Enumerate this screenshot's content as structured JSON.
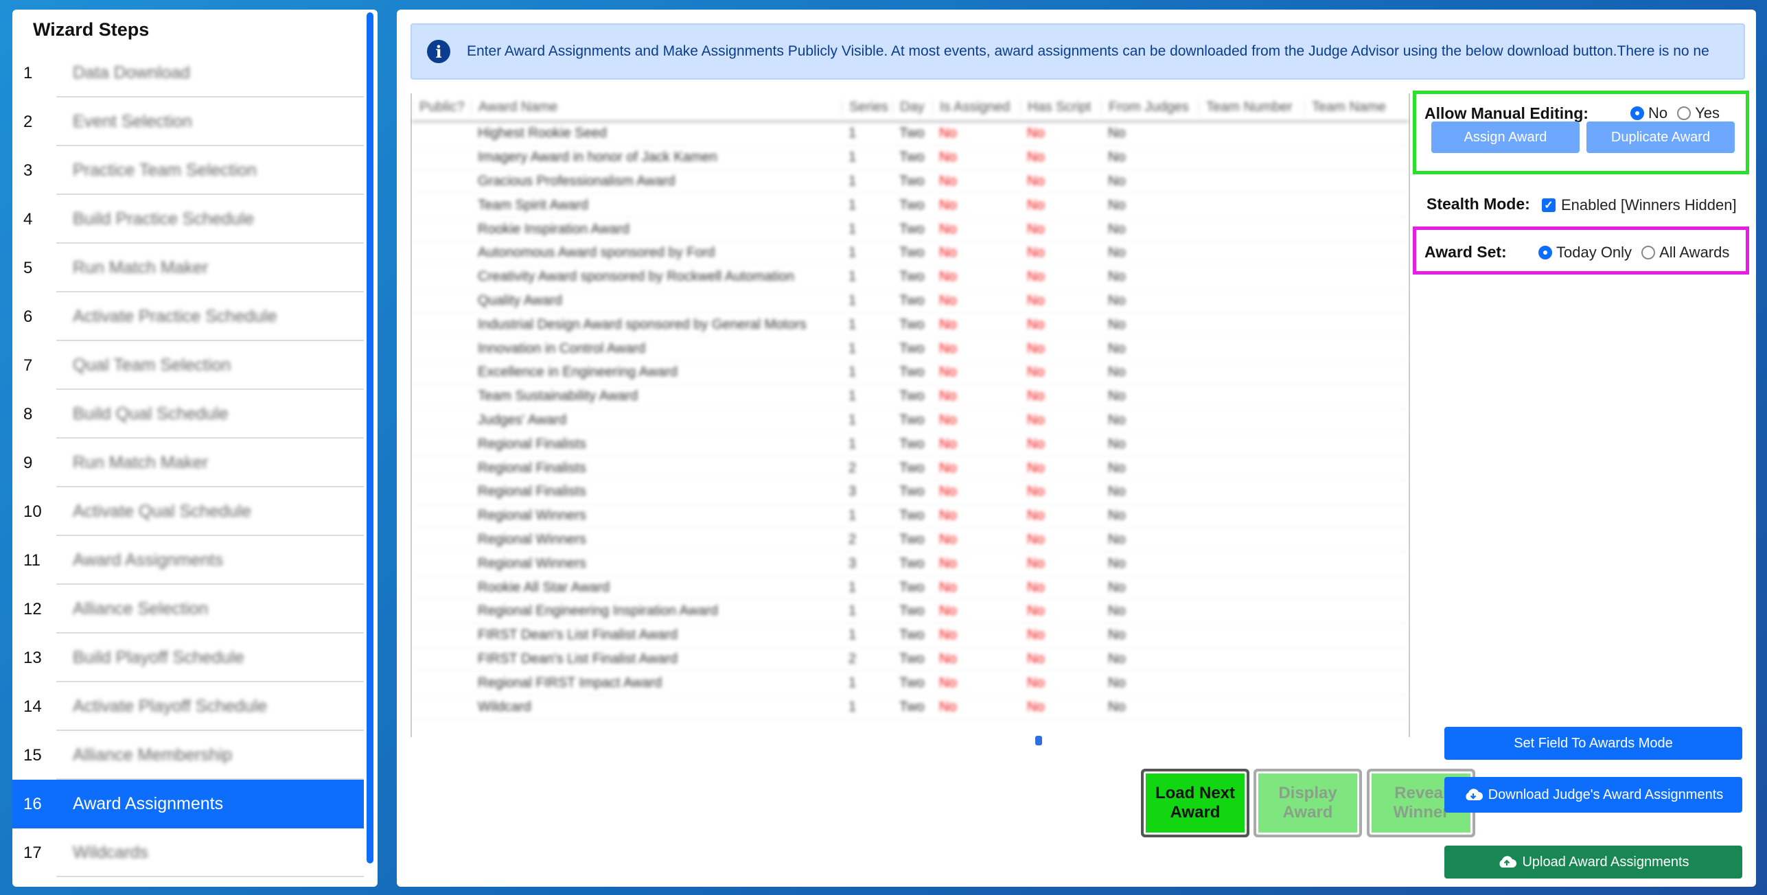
{
  "sidebar": {
    "title": "Wizard Steps",
    "steps": [
      {
        "num": "1",
        "label": "Data Download"
      },
      {
        "num": "2",
        "label": "Event Selection"
      },
      {
        "num": "3",
        "label": "Practice Team Selection"
      },
      {
        "num": "4",
        "label": "Build Practice Schedule"
      },
      {
        "num": "5",
        "label": "Run Match Maker"
      },
      {
        "num": "6",
        "label": "Activate Practice Schedule"
      },
      {
        "num": "7",
        "label": "Qual Team Selection"
      },
      {
        "num": "8",
        "label": "Build Qual Schedule"
      },
      {
        "num": "9",
        "label": "Run Match Maker"
      },
      {
        "num": "10",
        "label": "Activate Qual Schedule"
      },
      {
        "num": "11",
        "label": "Award Assignments"
      },
      {
        "num": "12",
        "label": "Alliance Selection"
      },
      {
        "num": "13",
        "label": "Build Playoff Schedule"
      },
      {
        "num": "14",
        "label": "Activate Playoff Schedule"
      },
      {
        "num": "15",
        "label": "Alliance Membership"
      },
      {
        "num": "16",
        "label": "Award Assignments"
      },
      {
        "num": "17",
        "label": "Wildcards"
      }
    ],
    "active_step": "16"
  },
  "banner": {
    "icon": "info-icon",
    "text": "Enter Award Assignments and Make Assignments Publicly Visible. At most events, award assignments can be downloaded from the Judge Advisor using the below download button.There is no ne"
  },
  "table": {
    "columns": [
      "Public?",
      "Award Name",
      "Series",
      "Day",
      "Is Assigned",
      "Has Script",
      "From Judges",
      "Team Number",
      "Team Name"
    ],
    "rows": [
      [
        "",
        "Highest Rookie Seed",
        "1",
        "Two",
        "No",
        "No",
        "No"
      ],
      [
        "",
        "Imagery Award in honor of Jack Kamen",
        "1",
        "Two",
        "No",
        "No",
        "No"
      ],
      [
        "",
        "Gracious Professionalism Award",
        "1",
        "Two",
        "No",
        "No",
        "No"
      ],
      [
        "",
        "Team Spirit Award",
        "1",
        "Two",
        "No",
        "No",
        "No"
      ],
      [
        "",
        "Rookie Inspiration Award",
        "1",
        "Two",
        "No",
        "No",
        "No"
      ],
      [
        "",
        "Autonomous Award sponsored by Ford",
        "1",
        "Two",
        "No",
        "No",
        "No"
      ],
      [
        "",
        "Creativity Award sponsored by Rockwell Automation",
        "1",
        "Two",
        "No",
        "No",
        "No"
      ],
      [
        "",
        "Quality Award",
        "1",
        "Two",
        "No",
        "No",
        "No"
      ],
      [
        "",
        "Industrial Design Award sponsored by General Motors",
        "1",
        "Two",
        "No",
        "No",
        "No"
      ],
      [
        "",
        "Innovation in Control Award",
        "1",
        "Two",
        "No",
        "No",
        "No"
      ],
      [
        "",
        "Excellence in Engineering Award",
        "1",
        "Two",
        "No",
        "No",
        "No"
      ],
      [
        "",
        "Team Sustainability Award",
        "1",
        "Two",
        "No",
        "No",
        "No"
      ],
      [
        "",
        "Judges' Award",
        "1",
        "Two",
        "No",
        "No",
        "No"
      ],
      [
        "",
        "Regional Finalists",
        "1",
        "Two",
        "No",
        "No",
        "No"
      ],
      [
        "",
        "Regional Finalists",
        "2",
        "Two",
        "No",
        "No",
        "No"
      ],
      [
        "",
        "Regional Finalists",
        "3",
        "Two",
        "No",
        "No",
        "No"
      ],
      [
        "",
        "Regional Winners",
        "1",
        "Two",
        "No",
        "No",
        "No"
      ],
      [
        "",
        "Regional Winners",
        "2",
        "Two",
        "No",
        "No",
        "No"
      ],
      [
        "",
        "Regional Winners",
        "3",
        "Two",
        "No",
        "No",
        "No"
      ],
      [
        "",
        "Rookie All Star Award",
        "1",
        "Two",
        "No",
        "No",
        "No"
      ],
      [
        "",
        "Regional Engineering Inspiration Award",
        "1",
        "Two",
        "No",
        "No",
        "No"
      ],
      [
        "",
        "FIRST Dean's List Finalist Award",
        "1",
        "Two",
        "No",
        "No",
        "No"
      ],
      [
        "",
        "FIRST Dean's List Finalist Award",
        "2",
        "Two",
        "No",
        "No",
        "No"
      ],
      [
        "",
        "Regional FIRST Impact Award",
        "1",
        "Two",
        "No",
        "No",
        "No"
      ],
      [
        "",
        "Wildcard",
        "1",
        "Two",
        "No",
        "No",
        "No"
      ]
    ]
  },
  "controls": {
    "load_next": "Load Next Award",
    "display": "Display Award",
    "reveal": "Reveal Winner"
  },
  "options": {
    "manual_editing_label": "Allow Manual Editing:",
    "manual_no": "No",
    "manual_yes": "Yes",
    "manual_selected": "No",
    "assign_award": "Assign Award",
    "duplicate_award": "Duplicate Award",
    "stealth_label": "Stealth Mode:",
    "stealth_checkbox": "Enabled [Winners Hidden]",
    "stealth_checked": true,
    "award_set_label": "Award Set:",
    "award_set_today": "Today Only",
    "award_set_all": "All Awards",
    "award_set_selected": "Today Only"
  },
  "actions": {
    "set_field": "Set Field To Awards Mode",
    "download": "Download Judge's Award Assignments",
    "upload": "Upload Award Assignments"
  },
  "colors": {
    "primary": "#0d6efd",
    "success": "#198754",
    "load_green": "#16d316",
    "highlight_green": "#2be02b",
    "highlight_magenta": "#e61ee6"
  }
}
